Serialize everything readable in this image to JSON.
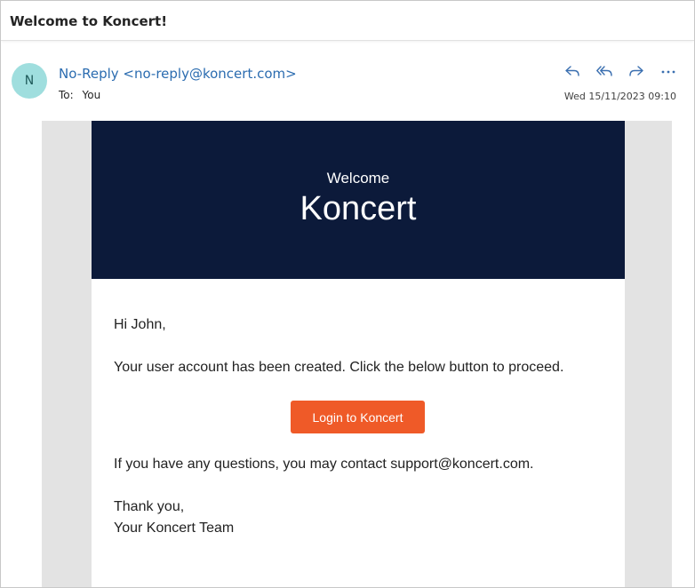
{
  "header": {
    "subject": "Welcome to Koncert!"
  },
  "message": {
    "avatar_initial": "N",
    "sender": "No-Reply <no-reply@koncert.com>",
    "to_label": "To:",
    "to_value": "You",
    "date": "Wed 15/11/2023 09:10",
    "actions": [
      "reply-icon",
      "reply-all-icon",
      "forward-icon",
      "more-icon"
    ]
  },
  "email": {
    "hero_small": "Welcome",
    "hero_big": "Koncert",
    "greeting": "Hi John,",
    "line1": "Your user account has been created. Click the below button to proceed.",
    "button_label": "Login to Koncert",
    "line2": "If you have any questions, you may contact support@koncert.com.",
    "signoff": "Thank you,",
    "signature": "Your Koncert Team",
    "colors": {
      "hero_bg": "#0c1a3a",
      "button": "#ef5a28"
    }
  }
}
